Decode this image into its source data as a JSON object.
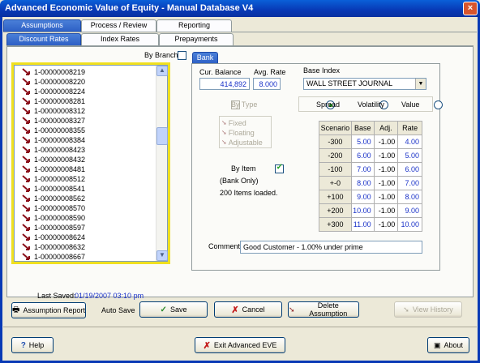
{
  "window": {
    "title": "Advanced Economic Value of Equity - Manual Database V4",
    "close_glyph": "×"
  },
  "top_tabs": [
    "Assumptions",
    "Process / Review",
    "Reporting"
  ],
  "sub_tabs": [
    "Discount Rates",
    "Index Rates",
    "Prepayments"
  ],
  "by_branch_label": "By Branch",
  "bank_tab": "Bank",
  "items": [
    "1-00000008219",
    "1-00000008220",
    "1-00000008224",
    "1-00000008281",
    "1-00000008312",
    "1-00000008327",
    "1-00000008355",
    "1-00000008384",
    "1-00000008423",
    "1-00000008432",
    "1-00000008481",
    "1-00000008512",
    "1-00000008541",
    "1-00000008562",
    "1-00000008570",
    "1-00000008590",
    "1-00000008597",
    "1-00000008624",
    "1-00000008632",
    "1-00000008667"
  ],
  "cur_balance": {
    "label": "Cur. Balance",
    "value": "414,892"
  },
  "avg_rate": {
    "label": "Avg. Rate",
    "value": "8.000"
  },
  "base_index": {
    "label": "Base Index",
    "selected": "WALL STREET JOURNAL"
  },
  "by_type": {
    "label": "By Type",
    "options": [
      "Fixed",
      "Floating",
      "Adjustable"
    ]
  },
  "mode": {
    "options": [
      "Spread",
      "Volatility",
      "Value"
    ],
    "selected": "Spread"
  },
  "by_item": {
    "label": "By Item",
    "sub": "(Bank Only)",
    "loaded": "200 Items loaded."
  },
  "grid": {
    "headers": [
      "Scenario",
      "Base",
      "Adj.",
      "Rate"
    ],
    "rows": [
      [
        "-300",
        "5.00",
        "-1.00",
        "4.00"
      ],
      [
        "-200",
        "6.00",
        "-1.00",
        "5.00"
      ],
      [
        "-100",
        "7.00",
        "-1.00",
        "6.00"
      ],
      [
        "+-0",
        "8.00",
        "-1.00",
        "7.00"
      ],
      [
        "+100",
        "9.00",
        "-1.00",
        "8.00"
      ],
      [
        "+200",
        "10.00",
        "-1.00",
        "9.00"
      ],
      [
        "+300",
        "11.00",
        "-1.00",
        "10.00"
      ]
    ]
  },
  "comment": {
    "label": "Comment:",
    "value": "Good Customer - 1.00% under prime"
  },
  "last_saved": {
    "label": "Last Saved:",
    "value": "01/19/2007 03:10 pm"
  },
  "buttons": {
    "assumption_report": "Assumption Report",
    "auto_save": "Auto Save",
    "save": "Save",
    "cancel": "Cancel",
    "delete": "Delete Assumption",
    "view_history": "View History",
    "help": "Help",
    "exit": "Exit Advanced EVE",
    "about": "About"
  },
  "colors": {
    "title_bar": "#0839b5",
    "blue_value": "#1a32c8",
    "active_tab": "#2d5fc5",
    "list_border": "#f0e020"
  }
}
